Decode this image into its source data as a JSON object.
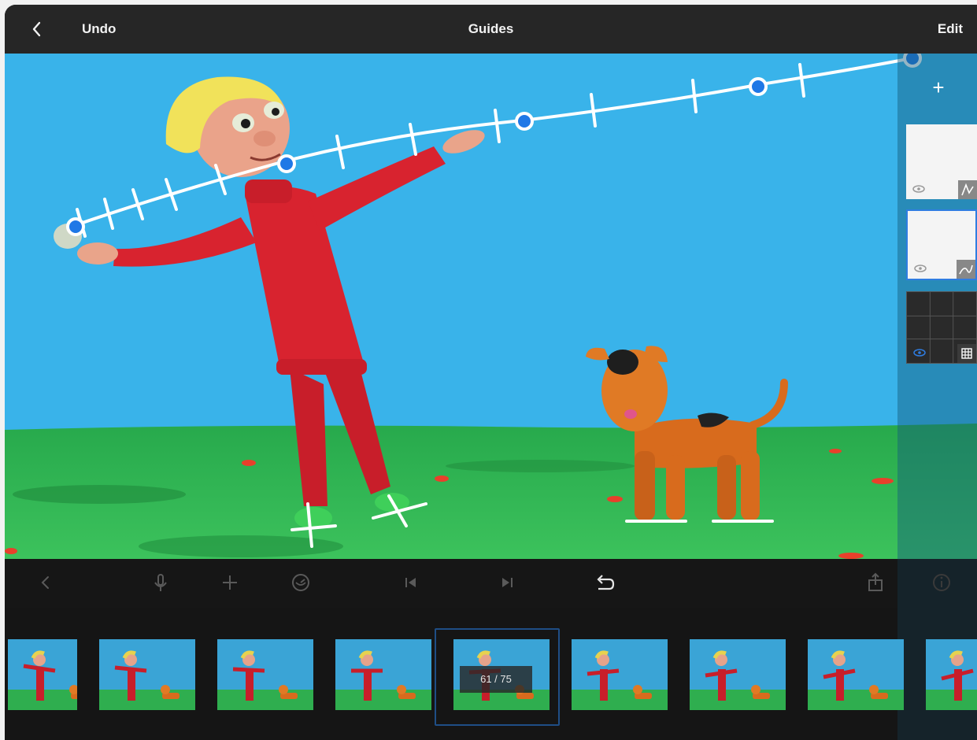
{
  "topbar": {
    "back_label": "<",
    "undo_label": "Undo",
    "title": "Guides",
    "edit_label": "Edit"
  },
  "sidepanel": {
    "add_label": "+",
    "layers": [
      {
        "type": "motion-path-layer",
        "icon": "path-icon",
        "visible": true,
        "selected": false
      },
      {
        "type": "curve-layer",
        "icon": "curve-icon",
        "visible": true,
        "selected": true
      },
      {
        "type": "grid-layer",
        "icon": "grid-icon",
        "visible": true,
        "selected": false
      }
    ]
  },
  "toolbar": {
    "icons": [
      "chevron-left-icon",
      "microphone-icon",
      "add-icon",
      "timer-icon",
      "skip-back-icon",
      "skip-forward-icon",
      "undo-arrow-icon",
      "share-icon",
      "info-icon"
    ]
  },
  "filmstrip": {
    "frame_count_visible": 9,
    "current_index": 4,
    "counter_text": "61 / 75"
  },
  "colors": {
    "sky": "#39b3ea",
    "grass": "#2fb34e",
    "accent": "#2f7de1",
    "topbar": "#262626",
    "dark": "#151515"
  }
}
